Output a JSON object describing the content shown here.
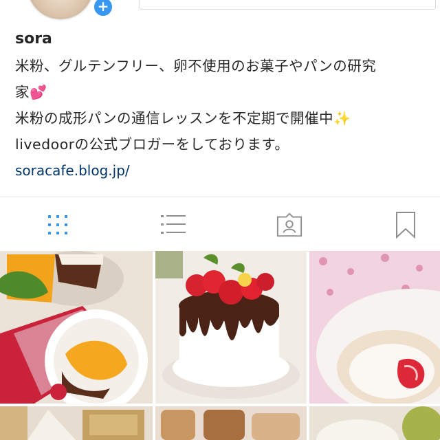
{
  "profile": {
    "username": "sora",
    "bio_lines": [
      "米粉、グルテンフリー、卵不使用のお菓子やパンの研究",
      "家",
      "米粉の成形パンの通信レッスンを不定期で開催中",
      "livedoorの公式ブロガーをしております。"
    ],
    "emoji_hearts": "💕",
    "emoji_sparkles": "✨",
    "website": "soracafe.blog.jp/"
  },
  "tabs": [
    {
      "icon": "grid-icon",
      "active": true
    },
    {
      "icon": "list-icon",
      "active": false
    },
    {
      "icon": "tagged-icon",
      "active": false
    },
    {
      "icon": "bookmark-icon",
      "active": false
    }
  ],
  "colors": {
    "accent": "#3897f0",
    "link": "#003569",
    "icon_inactive": "#8e8e8e"
  },
  "posts": [
    {
      "subject": "sweet potato tart with strawberries"
    },
    {
      "subject": "chocolate drip strawberry cake"
    },
    {
      "subject": "strawberry roll cake on floral cloth"
    },
    {
      "subject": "food photo"
    },
    {
      "subject": "bread and toast"
    },
    {
      "subject": "green soup"
    }
  ]
}
